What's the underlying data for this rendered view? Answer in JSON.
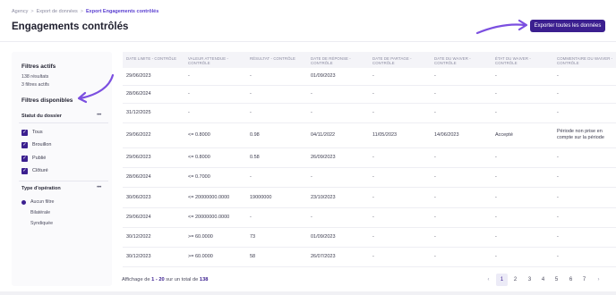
{
  "breadcrumb": [
    "Agency",
    "Export de données",
    "Export Engagements contrôlés"
  ],
  "page_title": "Engagements contrôlés",
  "export_button": "Exporter toutes les données",
  "colors": {
    "primary": "#3b1f8f",
    "arrow": "#7b4fe0"
  },
  "sidebar": {
    "active_title": "Filtres actifs",
    "results": "138 résultats",
    "filters_count": "3 filtres actifs",
    "available_title": "Filtres disponibles",
    "status_section": {
      "title": "Statut du dossier",
      "more": "•••",
      "options": [
        "Tous",
        "Brouillon",
        "Publié",
        "Clôturé"
      ]
    },
    "type_section": {
      "title": "Type d'opération",
      "more": "•••",
      "options": [
        "Aucun filtre",
        "Bilatérale",
        "Syndiquée"
      ],
      "selected": 0
    }
  },
  "table": {
    "columns": [
      "DATE LIMITE - CONTRÔLE",
      "VALEUR ATTENDUE - CONTRÔLE",
      "RÉSULTAT - CONTRÔLE",
      "DATE DE RÉPONSE - CONTRÔLE",
      "DATE DE PARTAGE - CONTRÔLE",
      "DATE DU WAIVER - CONTRÔLE",
      "ÉTAT DU WAIVER - CONTRÔLE",
      "COMMENTAIRE DU WAIVER - CONTRÔLE"
    ],
    "rows": [
      [
        "29/06/2023",
        "-",
        "-",
        "01/09/2023",
        "-",
        "-",
        "-",
        "-"
      ],
      [
        "28/06/2024",
        "-",
        "-",
        "-",
        "-",
        "-",
        "-",
        "-"
      ],
      [
        "31/12/2025",
        "-",
        "-",
        "-",
        "-",
        "-",
        "-",
        "-"
      ],
      [
        "29/06/2022",
        "<= 0.8000",
        "0.98",
        "04/11/2022",
        "11/05/2023",
        "14/06/2023",
        "Accepté",
        "Période non prise en compte sur la période"
      ],
      [
        "29/06/2023",
        "<= 0.8000",
        "0.58",
        "26/09/2023",
        "-",
        "-",
        "-",
        "-"
      ],
      [
        "28/06/2024",
        "<= 0.7000",
        "-",
        "-",
        "-",
        "-",
        "-",
        "-"
      ],
      [
        "30/06/2023",
        "<= 20000000.0000",
        "19000000",
        "23/10/2023",
        "-",
        "-",
        "-",
        "-"
      ],
      [
        "29/06/2024",
        "<= 20000000.0000",
        "-",
        "-",
        "-",
        "-",
        "-",
        "-"
      ],
      [
        "30/12/2022",
        ">= 60.0000",
        "73",
        "01/09/2023",
        "-",
        "-",
        "-",
        "-"
      ],
      [
        "30/12/2023",
        ">= 60.0000",
        "58",
        "26/07/2023",
        "-",
        "-",
        "-",
        "-"
      ]
    ]
  },
  "footer": {
    "prefix": "Affichage de",
    "range": "1 - 20",
    "middle": "sur un total de",
    "total": "138",
    "pages": [
      "1",
      "2",
      "3",
      "4",
      "5",
      "6",
      "7"
    ],
    "prev": "‹",
    "next": "›"
  }
}
